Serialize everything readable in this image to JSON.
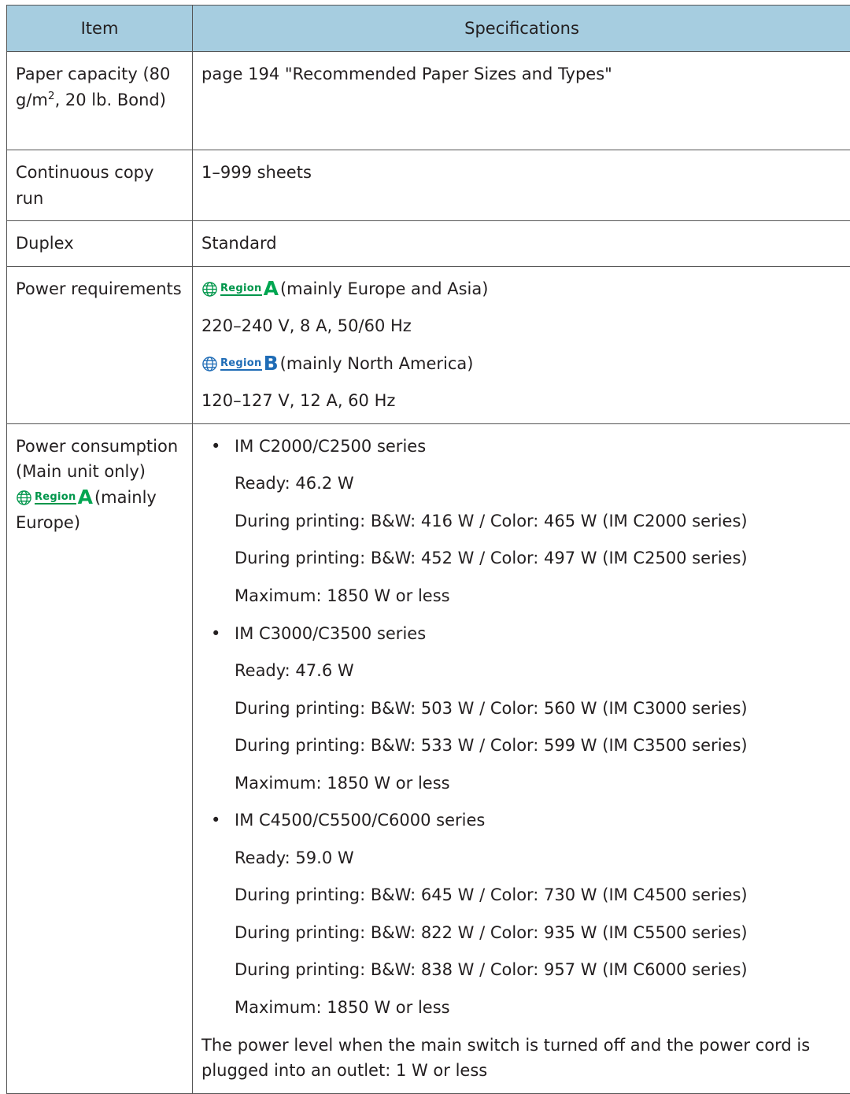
{
  "header": {
    "item": "Item",
    "specifications": "Specifications"
  },
  "rows": {
    "paper_capacity": {
      "item_pre": "Paper capacity (80 g/m",
      "item_sup": "2",
      "item_post": ", 20 lb. Bond)",
      "spec": "page 194 \"Recommended Paper Sizes and Types\""
    },
    "continuous_copy": {
      "item": "Continuous copy run",
      "spec": "1–999 sheets"
    },
    "duplex": {
      "item": "Duplex",
      "spec": "Standard"
    },
    "power_requirements": {
      "item": "Power requirements",
      "region_a_note": "(mainly Europe and Asia)",
      "region_a_value": "220–240 V, 8 A, 50/60 Hz",
      "region_b_note": "(mainly North America)",
      "region_b_value": "120–127 V, 12 A, 60 Hz"
    },
    "power_consumption": {
      "item_line1": "Power consumption",
      "item_line2": "(Main unit only)",
      "item_region_note": "(mainly",
      "item_line4": "Europe)",
      "series": [
        {
          "name": "IM C2000/C2500 series",
          "lines": [
            "Ready: 46.2 W",
            "During printing: B&W: 416 W / Color: 465 W (IM C2000 series)",
            "During printing: B&W: 452 W / Color: 497 W (IM C2500 series)",
            "Maximum: 1850 W or less"
          ]
        },
        {
          "name": "IM C3000/C3500 series",
          "lines": [
            "Ready: 47.6 W",
            "During printing: B&W: 503 W / Color: 560 W (IM C3000 series)",
            "During printing: B&W: 533 W / Color: 599 W (IM C3500 series)",
            "Maximum: 1850 W or less"
          ]
        },
        {
          "name": "IM C4500/C5500/C6000 series",
          "lines": [
            "Ready: 59.0 W",
            "During printing: B&W: 645 W / Color: 730 W (IM C4500 series)",
            "During printing: B&W: 822 W / Color: 935 W (IM C5500 series)",
            "During printing: B&W: 838 W / Color: 957 W (IM C6000 series)",
            "Maximum: 1850 W or less"
          ]
        }
      ],
      "footer_note": "The power level when the main switch is turned off and the power cord is plugged into an outlet: 1 W or less"
    }
  },
  "region_badge": {
    "word": "Region",
    "letter_a": "A",
    "letter_b": "B",
    "icon": "globe-icon"
  },
  "colors": {
    "header_bg": "#a6cde0",
    "region_a": "#00a651",
    "region_b": "#1f6cb6"
  }
}
